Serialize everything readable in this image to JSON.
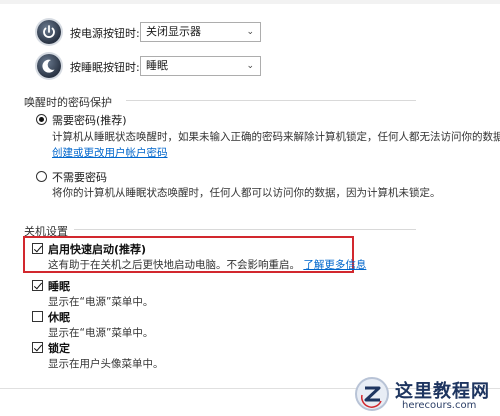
{
  "power_button": {
    "label": "按电源按钮时:",
    "value": "关闭显示器",
    "icon": "power-icon"
  },
  "sleep_button": {
    "label": "按睡眠按钮时:",
    "value": "睡眠",
    "icon": "moon-icon"
  },
  "wake_password": {
    "title": "唤醒时的密码保护",
    "require": {
      "label": "需要密码(推荐)",
      "desc": "计算机从睡眠状态唤醒时，如果未输入正确的密码来解除计算机锁定，任何人都无法访问你的数据。",
      "link": "创建或更改用户帐户密码",
      "selected": true
    },
    "no_require": {
      "label": "不需要密码",
      "desc": "将你的计算机从睡眠状态唤醒时，任何人都可以访问你的数据，因为计算机未锁定。",
      "selected": false
    }
  },
  "shutdown": {
    "title": "关机设置",
    "fast_startup": {
      "label": "启用快速启动(推荐)",
      "desc": "这有助于在关机之后更快地启动电脑。不会影响重启。",
      "link": "了解更多信息",
      "checked": true
    },
    "sleep": {
      "label": "睡眠",
      "desc": "显示在“电源”菜单中。",
      "checked": true
    },
    "hibernate": {
      "label": "休眠",
      "desc": "显示在“电源”菜单中。",
      "checked": false
    },
    "lock": {
      "label": "锁定",
      "desc": "显示在用户头像菜单中。",
      "checked": true
    }
  },
  "watermark": {
    "title": "这里教程网",
    "url": "herecours.com"
  },
  "colors": {
    "link": "#0066cc",
    "highlight": "#d2282e"
  }
}
